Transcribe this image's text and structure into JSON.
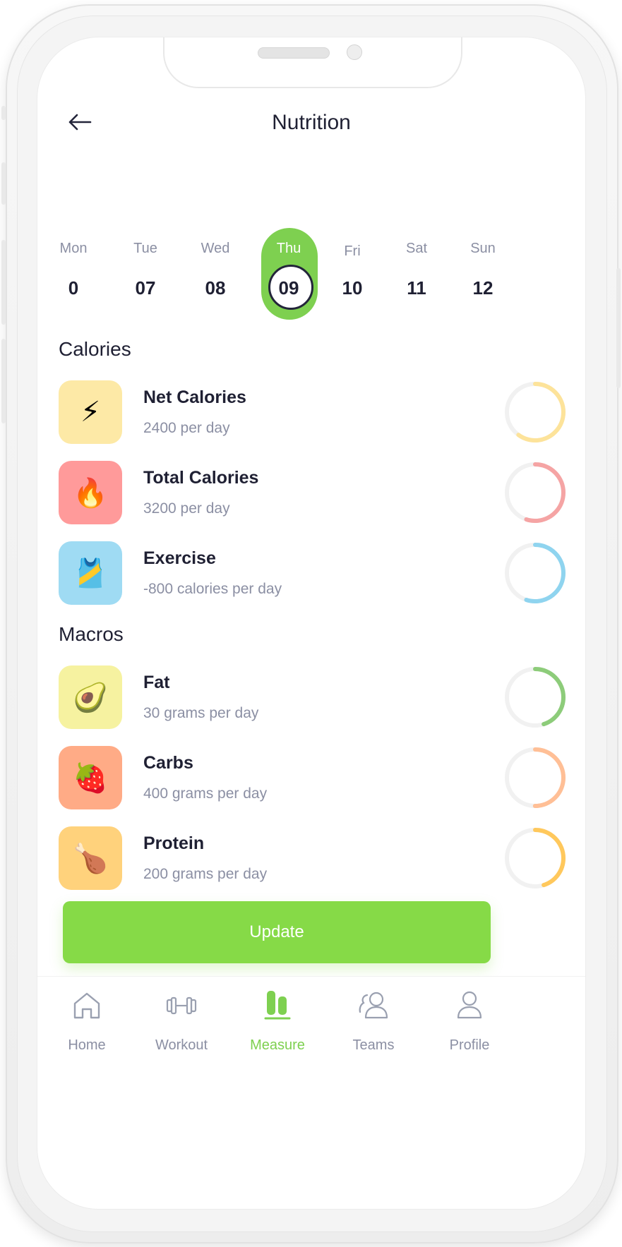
{
  "header": {
    "title": "Nutrition"
  },
  "week": [
    {
      "name": "Mon",
      "num": "0"
    },
    {
      "name": "Tue",
      "num": "07"
    },
    {
      "name": "Wed",
      "num": "08"
    },
    {
      "name": "Thu",
      "num": "09",
      "selected": true
    },
    {
      "name": "Fri",
      "num": "10"
    },
    {
      "name": "Sat",
      "num": "11"
    },
    {
      "name": "Sun",
      "num": "12"
    }
  ],
  "calories": {
    "title": "Calories",
    "items": [
      {
        "title": "Net Calories",
        "subtitle": "2400 per day",
        "icon": "lightning-icon",
        "emoji": "⚡",
        "tile": "#fde9a6",
        "ring": "#fde39a",
        "ring_progress": 0.6
      },
      {
        "title": "Total Calories",
        "subtitle": "3200 per day",
        "icon": "fire-icon",
        "emoji": "🔥",
        "tile": "#ff9a9a",
        "ring": "#f5a4a4",
        "ring_progress": 0.55
      },
      {
        "title": "Exercise",
        "subtitle": "-800 calories per day",
        "icon": "tank-top-icon",
        "emoji": "🎽",
        "tile": "#9fdbf3",
        "ring": "#8fd4ef",
        "ring_progress": 0.55
      }
    ]
  },
  "macros": {
    "title": "Macros",
    "items": [
      {
        "title": "Fat",
        "subtitle": "30 grams per day",
        "icon": "avocado-icon",
        "emoji": "🥑",
        "tile": "#f6f2a0",
        "ring": "#8dcc7a",
        "ring_progress": 0.45
      },
      {
        "title": "Carbs",
        "subtitle": "400 grams per day",
        "icon": "strawberry-icon",
        "emoji": "🍓",
        "tile": "#ffab86",
        "ring": "#ffbf96",
        "ring_progress": 0.5
      },
      {
        "title": "Protein",
        "subtitle": "200 grams per day",
        "icon": "drumstick-icon",
        "emoji": "🍗",
        "tile": "#ffd27c",
        "ring": "#ffc85c",
        "ring_progress": 0.45
      }
    ]
  },
  "actions": {
    "update_label": "Update"
  },
  "tabbar": {
    "active_color": "#7ed050",
    "items": [
      {
        "label": "Home",
        "icon": "home-icon"
      },
      {
        "label": "Workout",
        "icon": "dumbbell-icon"
      },
      {
        "label": "Measure",
        "icon": "measure-icon",
        "active": true
      },
      {
        "label": "Teams",
        "icon": "teams-icon"
      },
      {
        "label": "Profile",
        "icon": "profile-icon"
      }
    ]
  }
}
